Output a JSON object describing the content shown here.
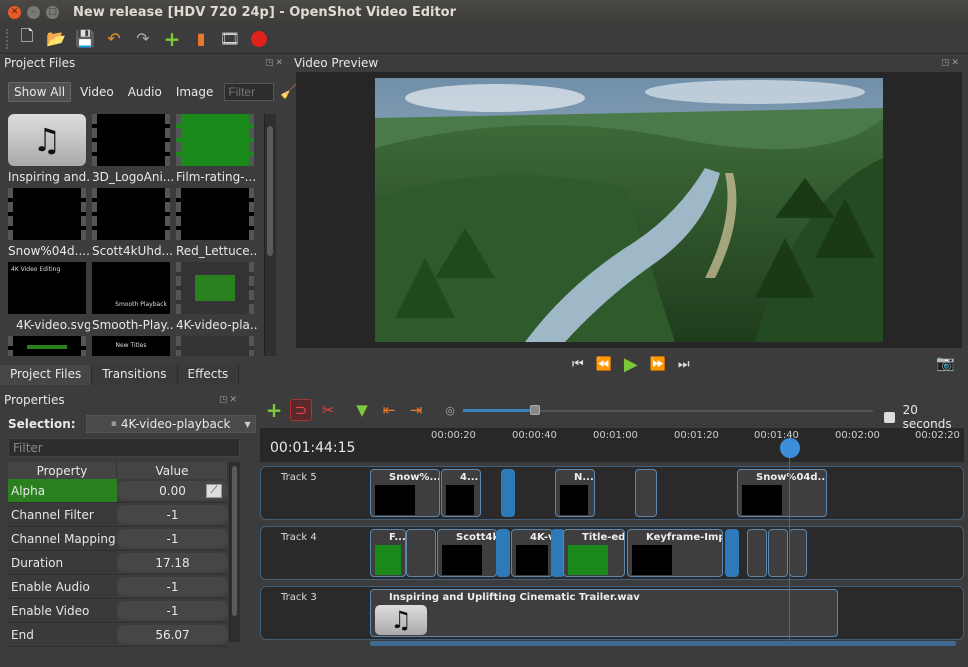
{
  "window": {
    "title": "New release [HDV 720 24p] - OpenShot Video Editor"
  },
  "toolbar": {
    "icons": [
      "new-project-icon",
      "open-project-icon",
      "save-project-icon",
      "undo-icon",
      "redo-icon",
      "import-files-icon",
      "profile-icon",
      "export-icon",
      "record-icon"
    ]
  },
  "project_files": {
    "header": "Project Files",
    "filters": [
      "Show All",
      "Video",
      "Audio",
      "Image"
    ],
    "filter_placeholder": "Filter",
    "items": [
      {
        "label": "Inspiring and...",
        "kind": "audio"
      },
      {
        "label": "3D_LogoAni...",
        "kind": "video"
      },
      {
        "label": "Film-rating-...",
        "kind": "green"
      },
      {
        "label": "Snow%04d....",
        "kind": "video"
      },
      {
        "label": "Scott4kUhd...",
        "kind": "video"
      },
      {
        "label": "Red_Lettuce....",
        "kind": "video"
      },
      {
        "label": "4K-video.svg",
        "kind": "video",
        "thumb_text": "4K Video Editing"
      },
      {
        "label": "Smooth-Play...",
        "kind": "video",
        "thumb_text": "Smooth Playback"
      },
      {
        "label": "4K-video-pla...",
        "kind": "video"
      },
      {
        "label": "",
        "kind": "green"
      },
      {
        "label": "",
        "kind": "video",
        "thumb_text": "New Titles"
      },
      {
        "label": "",
        "kind": "video"
      }
    ]
  },
  "bottom_tabs": [
    "Project Files",
    "Transitions",
    "Effects"
  ],
  "properties": {
    "header": "Properties",
    "selection_label": "Selection:",
    "selection_value": "4K-video-playback",
    "filter_placeholder": "Filter",
    "col_property": "Property",
    "col_value": "Value",
    "rows": [
      {
        "name": "Alpha",
        "value": "0.00"
      },
      {
        "name": "Channel Filter",
        "value": "-1"
      },
      {
        "name": "Channel Mapping",
        "value": "-1"
      },
      {
        "name": "Duration",
        "value": "17.18"
      },
      {
        "name": "Enable Audio",
        "value": "-1"
      },
      {
        "name": "Enable Video",
        "value": "-1"
      },
      {
        "name": "End",
        "value": "56.07"
      }
    ]
  },
  "video_preview": {
    "header": "Video Preview"
  },
  "timeline": {
    "timecode": "00:01:44:15",
    "zoom_label": "20 seconds",
    "ruler": [
      "00:00:20",
      "00:00:40",
      "00:01:00",
      "00:01:20",
      "00:01:40",
      "00:02:00",
      "00:02:20"
    ],
    "tracks": [
      {
        "name": "Track 5",
        "clips": [
          {
            "title": "Snow%..."
          },
          {
            "title": "4..."
          },
          {
            "title": ""
          },
          {
            "title": "N..."
          },
          {
            "title": ""
          },
          {
            "title": "Snow%04d..."
          }
        ]
      },
      {
        "name": "Track 4",
        "clips": [
          {
            "title": "F..."
          },
          {
            "title": ""
          },
          {
            "title": "Scott4k"
          },
          {
            "title": "4K-vide"
          },
          {
            "title": "Title-edit..."
          },
          {
            "title": "Keyframe-Improv"
          },
          {
            "title": ""
          },
          {
            "title": ""
          },
          {
            "title": ""
          }
        ]
      },
      {
        "name": "Track 3",
        "clips": [
          {
            "title": "Inspiring and Uplifting Cinematic Trailer.wav"
          }
        ]
      }
    ]
  }
}
